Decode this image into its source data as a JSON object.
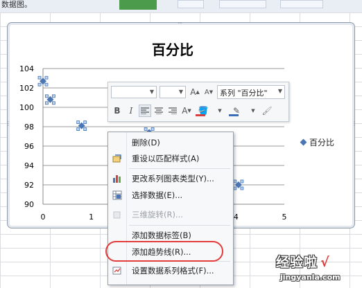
{
  "window": {
    "top_fragment": "数据图。"
  },
  "chart_data": {
    "type": "scatter",
    "title": "百分比",
    "series": [
      {
        "name": "百分比",
        "x": [
          0,
          0.15,
          0.8,
          2.2,
          4.05
        ],
        "y": [
          102.7,
          100.8,
          98.1,
          97.4,
          92.0
        ]
      }
    ],
    "xlim": [
      0,
      5
    ],
    "ylim": [
      90,
      104
    ],
    "xticks": [
      "0",
      "1",
      "3",
      "4",
      "5"
    ],
    "yticks": [
      "90",
      "92",
      "94",
      "96",
      "98",
      "100",
      "102",
      "104"
    ],
    "grid": "horizontal",
    "legend": "right",
    "marker_color": "#4a76b4"
  },
  "mini_toolbar": {
    "series_selector": "系列 \"百分比\"",
    "bold": "B",
    "italic": "I",
    "grow_font": "A",
    "shrink_font": "A",
    "font_color": "A"
  },
  "context_menu": {
    "items": [
      {
        "label": "删除(D)",
        "icon": "none",
        "enabled": true
      },
      {
        "label": "重设以匹配样式(A)",
        "icon": "reset-style-icon",
        "enabled": true
      },
      {
        "label": "更改系列图表类型(Y)...",
        "icon": "chart-type-icon",
        "enabled": true
      },
      {
        "label": "选择数据(E)...",
        "icon": "select-data-icon",
        "enabled": true
      },
      {
        "label": "三维旋转(R)...",
        "icon": "3d-rotate-icon",
        "enabled": false
      },
      {
        "label": "添加数据标签(B)",
        "icon": "none",
        "enabled": true
      },
      {
        "label": "添加趋势线(R)...",
        "icon": "none",
        "enabled": true
      },
      {
        "label": "设置数据系列格式(F)...",
        "icon": "format-series-icon",
        "enabled": true
      }
    ]
  },
  "highlight": {
    "color": "#e33a3a"
  },
  "watermark": {
    "main": "经验啦",
    "check": "√",
    "sub": "jingyanla.com"
  }
}
